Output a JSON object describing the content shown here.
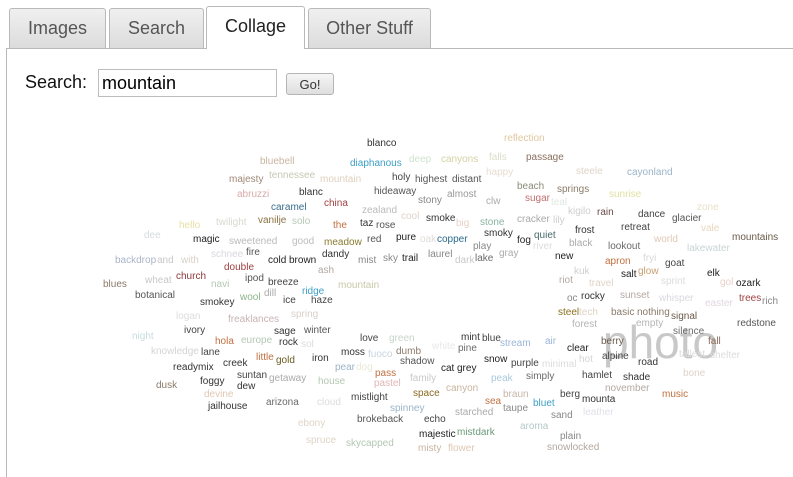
{
  "tabs": [
    {
      "label": "Images"
    },
    {
      "label": "Search"
    },
    {
      "label": "Collage"
    },
    {
      "label": "Other Stuff"
    }
  ],
  "search": {
    "label": "Search:",
    "value": "mountain",
    "button": "Go!"
  },
  "cloud": {
    "words": [
      {
        "text": "blanco",
        "color": "#333333"
      },
      {
        "text": "reflection",
        "color": "#e0c8a0"
      },
      {
        "text": "bluebell",
        "color": "#c8b4a0"
      },
      {
        "text": "diaphanous",
        "color": "#3d9fc8"
      },
      {
        "text": "deep",
        "color": "#cfe4cf"
      },
      {
        "text": "canyons",
        "color": "#d2d2a4"
      },
      {
        "text": "falls",
        "color": "#dcdcc8"
      },
      {
        "text": "passage",
        "color": "#8a7060"
      },
      {
        "text": "majesty",
        "color": "#a08878"
      },
      {
        "text": "tennessee",
        "color": "#c8c8b4"
      },
      {
        "text": "mountain",
        "color": "#e0d0c0"
      },
      {
        "text": "holy",
        "color": "#444444"
      },
      {
        "text": "highest",
        "color": "#555555"
      },
      {
        "text": "distant",
        "color": "#555555"
      },
      {
        "text": "happy",
        "color": "#e8dcd0"
      },
      {
        "text": "steele",
        "color": "#e0d4c8"
      },
      {
        "text": "cayonland",
        "color": "#9ab4c8"
      },
      {
        "text": "abruzzi",
        "color": "#d8aaaa"
      },
      {
        "text": "blanc",
        "color": "#333333"
      },
      {
        "text": "hideaway",
        "color": "#555555"
      },
      {
        "text": "almost",
        "color": "#999999"
      },
      {
        "text": "beach",
        "color": "#8a8a78"
      },
      {
        "text": "springs",
        "color": "#8a7a6a"
      },
      {
        "text": "sunrise",
        "color": "#e0e0a4"
      },
      {
        "text": "caramel",
        "color": "#3a6e8c"
      },
      {
        "text": "china",
        "color": "#a04040"
      },
      {
        "text": "stony",
        "color": "#888888"
      },
      {
        "text": "clw",
        "color": "#aaaaaa"
      },
      {
        "text": "sugar",
        "color": "#c07070"
      },
      {
        "text": "teal",
        "color": "#e0e8e0"
      },
      {
        "text": "zone",
        "color": "#e8e0c8"
      },
      {
        "text": "zealand",
        "color": "#bbbbbb"
      },
      {
        "text": "kigilo",
        "color": "#cfcfcf"
      },
      {
        "text": "rain",
        "color": "#6a4a4a"
      },
      {
        "text": "dance",
        "color": "#444444"
      },
      {
        "text": "glacier",
        "color": "#555555"
      },
      {
        "text": "hello",
        "color": "#e8e0a4"
      },
      {
        "text": "twilight",
        "color": "#d8d8d0"
      },
      {
        "text": "vanilje",
        "color": "#8a7040"
      },
      {
        "text": "solo",
        "color": "#b4c8b4"
      },
      {
        "text": "the",
        "color": "#c07040"
      },
      {
        "text": "taz",
        "color": "#333333"
      },
      {
        "text": "rose",
        "color": "#555555"
      },
      {
        "text": "cool",
        "color": "#e0d4c8"
      },
      {
        "text": "smoke",
        "color": "#333333"
      },
      {
        "text": "big",
        "color": "#e8d0c8"
      },
      {
        "text": "stone",
        "color": "#8ab4a0"
      },
      {
        "text": "cracker",
        "color": "#aaaaaa"
      },
      {
        "text": "lily",
        "color": "#cfcfcf"
      },
      {
        "text": "frost",
        "color": "#333333"
      },
      {
        "text": "retreat",
        "color": "#444444"
      },
      {
        "text": "vale",
        "color": "#e8d8c0"
      },
      {
        "text": "mountains",
        "color": "#6a5a4a"
      },
      {
        "text": "dee",
        "color": "#d4dcdc"
      },
      {
        "text": "magic",
        "color": "#222222"
      },
      {
        "text": "sweetened",
        "color": "#bbbbbb"
      },
      {
        "text": "good",
        "color": "#bbbbbb"
      },
      {
        "text": "meadow",
        "color": "#8a7a30"
      },
      {
        "text": "red",
        "color": "#555555"
      },
      {
        "text": "pure",
        "color": "#222222"
      },
      {
        "text": "oak",
        "color": "#e0dcd8"
      },
      {
        "text": "copper",
        "color": "#2a6a8c"
      },
      {
        "text": "smoky",
        "color": "#333333"
      },
      {
        "text": "fog",
        "color": "#222222"
      },
      {
        "text": "quiet",
        "color": "#4a6a6a"
      },
      {
        "text": "black",
        "color": "#aaaaaa"
      },
      {
        "text": "lookout",
        "color": "#6a6a6a"
      },
      {
        "text": "world",
        "color": "#e0c8b4"
      },
      {
        "text": "lakewater",
        "color": "#c8d4d4"
      },
      {
        "text": "fire",
        "color": "#555555"
      },
      {
        "text": "dandy",
        "color": "#333333"
      },
      {
        "text": "play",
        "color": "#888888"
      },
      {
        "text": "river",
        "color": "#dcdcdc"
      },
      {
        "text": "backdrop",
        "color": "#aab4c8"
      },
      {
        "text": "and",
        "color": "#c8c8c8"
      },
      {
        "text": "with",
        "color": "#d8d0c8"
      },
      {
        "text": "schnee",
        "color": "#d8d8e0"
      },
      {
        "text": "cold",
        "color": "#222222"
      },
      {
        "text": "brown",
        "color": "#222222"
      },
      {
        "text": "mist",
        "color": "#888888"
      },
      {
        "text": "sky",
        "color": "#888888"
      },
      {
        "text": "trail",
        "color": "#222222"
      },
      {
        "text": "laurel",
        "color": "#888888"
      },
      {
        "text": "dark",
        "color": "#c8c8c8"
      },
      {
        "text": "lake",
        "color": "#6a6a6a"
      },
      {
        "text": "gray",
        "color": "#aaaaaa"
      },
      {
        "text": "new",
        "color": "#222222"
      },
      {
        "text": "apron",
        "color": "#c07040"
      },
      {
        "text": "fryi",
        "color": "#d8d8d8"
      },
      {
        "text": "goat",
        "color": "#444444"
      },
      {
        "text": "double",
        "color": "#a04040"
      },
      {
        "text": "ash",
        "color": "#b4a8a0"
      },
      {
        "text": "kuk",
        "color": "#cfcfcf"
      },
      {
        "text": "glow",
        "color": "#c8a070"
      },
      {
        "text": "elk",
        "color": "#222222"
      },
      {
        "text": "blues",
        "color": "#8a7a6a"
      },
      {
        "text": "wheat",
        "color": "#c8c8c8"
      },
      {
        "text": "church",
        "color": "#8a3a3a"
      },
      {
        "text": "navi",
        "color": "#b4c8b4"
      },
      {
        "text": "ipod",
        "color": "#555555"
      },
      {
        "text": "breeze",
        "color": "#444444"
      },
      {
        "text": "riot",
        "color": "#b4a8a0"
      },
      {
        "text": "travel",
        "color": "#e0d4c8"
      },
      {
        "text": "salt",
        "color": "#222222"
      },
      {
        "text": "sprint",
        "color": "#dcdcdc"
      },
      {
        "text": "gol",
        "color": "#e8d0c8"
      },
      {
        "text": "ozark",
        "color": "#222222"
      },
      {
        "text": "botanical",
        "color": "#555555"
      },
      {
        "text": "wool",
        "color": "#8ab48a"
      },
      {
        "text": "dill",
        "color": "#aaaaaa"
      },
      {
        "text": "ridge",
        "color": "#3d9fc8"
      },
      {
        "text": "oc",
        "color": "#888888"
      },
      {
        "text": "rocky",
        "color": "#333333"
      },
      {
        "text": "sunset",
        "color": "#b4a8a0"
      },
      {
        "text": "whisper",
        "color": "#d8d8e0"
      },
      {
        "text": "easter",
        "color": "#e0d8e0"
      },
      {
        "text": "trees",
        "color": "#a04040"
      },
      {
        "text": "rich",
        "color": "#888888"
      },
      {
        "text": "smokey",
        "color": "#333333"
      },
      {
        "text": "ice",
        "color": "#444444"
      },
      {
        "text": "haze",
        "color": "#444444"
      },
      {
        "text": "mountain",
        "color": "#c8c8a8"
      },
      {
        "text": "steel",
        "color": "#8a7020"
      },
      {
        "text": "tech",
        "color": "#e0d4c8"
      },
      {
        "text": "basic",
        "color": "#8a7a6a"
      },
      {
        "text": "nothing",
        "color": "#8a7a6a"
      },
      {
        "text": "logan",
        "color": "#dcdcdc"
      },
      {
        "text": "freaklances",
        "color": "#c8b4b4"
      },
      {
        "text": "spring",
        "color": "#d8d0c8"
      },
      {
        "text": "forest",
        "color": "#b4b4b4"
      },
      {
        "text": "photo",
        "color": "#c8c8c8"
      },
      {
        "text": "empty",
        "color": "#b4b4b4"
      },
      {
        "text": "signal",
        "color": "#6a5a4a"
      },
      {
        "text": "redstone",
        "color": "#555555"
      },
      {
        "text": "night",
        "color": "#c8dcdc"
      },
      {
        "text": "ivory",
        "color": "#444444"
      },
      {
        "text": "sage",
        "color": "#333333"
      },
      {
        "text": "winter",
        "color": "#555555"
      },
      {
        "text": "silence",
        "color": "#6a6a6a"
      },
      {
        "text": "hola",
        "color": "#c07040"
      },
      {
        "text": "europe",
        "color": "#b4c8b4"
      },
      {
        "text": "rock",
        "color": "#333333"
      },
      {
        "text": "sol",
        "color": "#e0dcd8"
      },
      {
        "text": "love",
        "color": "#444444"
      },
      {
        "text": "green",
        "color": "#c8d4c8"
      },
      {
        "text": "white",
        "color": "#e8e8e8"
      },
      {
        "text": "mint",
        "color": "#333333"
      },
      {
        "text": "blue",
        "color": "#444444"
      },
      {
        "text": "stream",
        "color": "#9ab4d8"
      },
      {
        "text": "air",
        "color": "#9ab4d8"
      },
      {
        "text": "berry",
        "color": "#6a5a4a"
      },
      {
        "text": "fall",
        "color": "#8a6a5a"
      },
      {
        "text": "knowledge",
        "color": "#d4d4d4"
      },
      {
        "text": "lane",
        "color": "#444444"
      },
      {
        "text": "little",
        "color": "#c07040"
      },
      {
        "text": "gold",
        "color": "#6a5a20"
      },
      {
        "text": "iron",
        "color": "#333333"
      },
      {
        "text": "moss",
        "color": "#333333"
      },
      {
        "text": "fuoco",
        "color": "#c8d4e0"
      },
      {
        "text": "dumb",
        "color": "#8a7a6a"
      },
      {
        "text": "pine",
        "color": "#6a6a6a"
      },
      {
        "text": "clear",
        "color": "#222222"
      },
      {
        "text": "tallest",
        "color": "#dcdcdc"
      },
      {
        "text": "shelter",
        "color": "#dcdcdc"
      },
      {
        "text": "creek",
        "color": "#333333"
      },
      {
        "text": "pear",
        "color": "#9ab4c8"
      },
      {
        "text": "dog",
        "color": "#e8e8d8"
      },
      {
        "text": "shadow",
        "color": "#555555"
      },
      {
        "text": "snow",
        "color": "#222222"
      },
      {
        "text": "purple",
        "color": "#444444"
      },
      {
        "text": "hot",
        "color": "#d4d4d4"
      },
      {
        "text": "alpine",
        "color": "#444444"
      },
      {
        "text": "road",
        "color": "#333333"
      },
      {
        "text": "readymix",
        "color": "#333333"
      },
      {
        "text": "suntan",
        "color": "#444444"
      },
      {
        "text": "pass",
        "color": "#c07040"
      },
      {
        "text": "cat",
        "color": "#222222"
      },
      {
        "text": "grey",
        "color": "#222222"
      },
      {
        "text": "minimal",
        "color": "#dcdcdc"
      },
      {
        "text": "bone",
        "color": "#e0d4c8"
      },
      {
        "text": "foggy",
        "color": "#333333"
      },
      {
        "text": "getaway",
        "color": "#aaaaaa"
      },
      {
        "text": "house",
        "color": "#b4c8b4"
      },
      {
        "text": "family",
        "color": "#c8c8c8"
      },
      {
        "text": "peak",
        "color": "#aac8dc"
      },
      {
        "text": "simply",
        "color": "#6a6a6a"
      },
      {
        "text": "hamlet",
        "color": "#444444"
      },
      {
        "text": "shade",
        "color": "#333333"
      },
      {
        "text": "dusk",
        "color": "#8a7a6a"
      },
      {
        "text": "dew",
        "color": "#333333"
      },
      {
        "text": "pastel",
        "color": "#e0b4b4"
      },
      {
        "text": "canyon",
        "color": "#c8b4a0"
      },
      {
        "text": "november",
        "color": "#b4a8a0"
      },
      {
        "text": "music",
        "color": "#c07040"
      },
      {
        "text": "devine",
        "color": "#e0c8b4"
      },
      {
        "text": "mistlight",
        "color": "#444444"
      },
      {
        "text": "space",
        "color": "#8a6a20"
      },
      {
        "text": "braun",
        "color": "#c8b4a8"
      },
      {
        "text": "berg",
        "color": "#444444"
      },
      {
        "text": "mounta",
        "color": "#333333"
      },
      {
        "text": "jailhouse",
        "color": "#333333"
      },
      {
        "text": "arizona",
        "color": "#6a6a6a"
      },
      {
        "text": "cloud",
        "color": "#dcdcdc"
      },
      {
        "text": "spinney",
        "color": "#9ab4c8"
      },
      {
        "text": "sea",
        "color": "#c07040"
      },
      {
        "text": "bluet",
        "color": "#3d9fc8"
      },
      {
        "text": "taupe",
        "color": "#888888"
      },
      {
        "text": "starched",
        "color": "#aaaaaa"
      },
      {
        "text": "sand",
        "color": "#888888"
      },
      {
        "text": "leather",
        "color": "#e0e0e8"
      },
      {
        "text": "ebony",
        "color": "#e0d4c8"
      },
      {
        "text": "brokeback",
        "color": "#555555"
      },
      {
        "text": "echo",
        "color": "#444444"
      },
      {
        "text": "aroma",
        "color": "#b4c8c8"
      },
      {
        "text": "majestic",
        "color": "#222222"
      },
      {
        "text": "mistdark",
        "color": "#6a9a7a"
      },
      {
        "text": "plain",
        "color": "#888888"
      },
      {
        "text": "spruce",
        "color": "#e0d4c8"
      },
      {
        "text": "skycapped",
        "color": "#b4c8b4"
      },
      {
        "text": "misty",
        "color": "#c8b4a0"
      },
      {
        "text": "flower",
        "color": "#e0c8b4"
      },
      {
        "text": "snowlocked",
        "color": "#b4a8a0"
      }
    ]
  }
}
